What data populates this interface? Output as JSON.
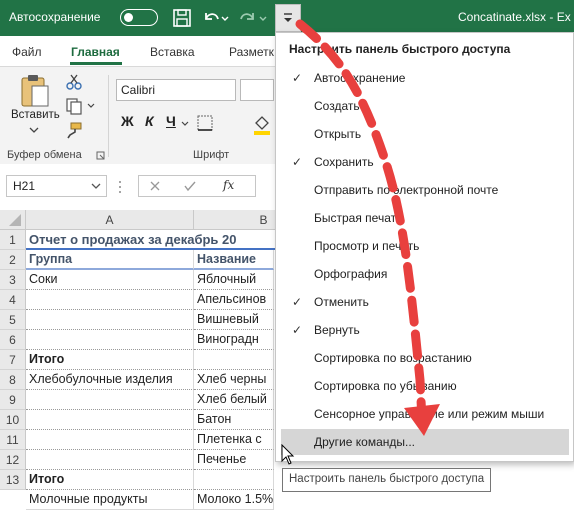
{
  "titlebar": {
    "autosave_label": "Автосохранение",
    "filename": "Concatinate.xlsx - Ex"
  },
  "ribbon": {
    "tabs": [
      {
        "label": "Файл"
      },
      {
        "label": "Главная"
      },
      {
        "label": "Вставка"
      },
      {
        "label": "Разметк"
      }
    ],
    "paste_label": "Вставить",
    "clipboard_group": "Буфер обмена",
    "font_group": "Шрифт",
    "font_name": "Calibri",
    "bold": "Ж",
    "italic": "К",
    "underline": "Ч"
  },
  "formula_bar": {
    "name_box": "H21",
    "fx": "fx"
  },
  "grid": {
    "columns": [
      "A",
      "B"
    ],
    "rows": [
      {
        "num": "1",
        "a": "Отчет о продажах за декабрь 20",
        "b": ""
      },
      {
        "num": "2",
        "a": "Группа",
        "b": "Название"
      },
      {
        "num": "3",
        "a": "Соки",
        "b": "Яблочный"
      },
      {
        "num": "4",
        "a": "",
        "b": "Апельсинов"
      },
      {
        "num": "5",
        "a": "",
        "b": "Вишневый"
      },
      {
        "num": "6",
        "a": "",
        "b": "Виноградн"
      },
      {
        "num": "7",
        "a": "Итого",
        "b": ""
      },
      {
        "num": "8",
        "a": "Хлебобулочные изделия",
        "b": "Хлеб черны"
      },
      {
        "num": "9",
        "a": "",
        "b": "Хлеб белый"
      },
      {
        "num": "10",
        "a": "",
        "b": "Батон"
      },
      {
        "num": "11",
        "a": "",
        "b": "Плетенка с"
      },
      {
        "num": "12",
        "a": "",
        "b": "Печенье"
      },
      {
        "num": "13",
        "a": "Итого",
        "b": ""
      }
    ],
    "partial_row_a": "Молочные продукты",
    "partial_row_b": "Молоко 1.5%"
  },
  "menu": {
    "title": "Настроить панель быстрого доступа",
    "items": [
      {
        "label": "Автосохранение",
        "checked": true
      },
      {
        "label": "Создать",
        "checked": false
      },
      {
        "label": "Открыть",
        "checked": false
      },
      {
        "label": "Сохранить",
        "checked": true
      },
      {
        "label": "Отправить по электронной почте",
        "checked": false
      },
      {
        "label": "Быстрая печать",
        "checked": false
      },
      {
        "label": "Просмотр и печать",
        "checked": false
      },
      {
        "label": "Орфография",
        "checked": false
      },
      {
        "label": "Отменить",
        "checked": true
      },
      {
        "label": "Вернуть",
        "checked": true
      },
      {
        "label": "Сортировка по возрастанию",
        "checked": false
      },
      {
        "label": "Сортировка по убыванию",
        "checked": false
      },
      {
        "label": "Сенсорное управление или режим мыши",
        "checked": false
      },
      {
        "label": "Другие команды...",
        "checked": false,
        "hover": true
      }
    ],
    "check_glyph": "✓"
  },
  "tooltip": "Настроить панель быстрого доступа",
  "colors": {
    "excel_green": "#217346",
    "arrow_red": "#e8403e",
    "title_text": "#44546a"
  }
}
